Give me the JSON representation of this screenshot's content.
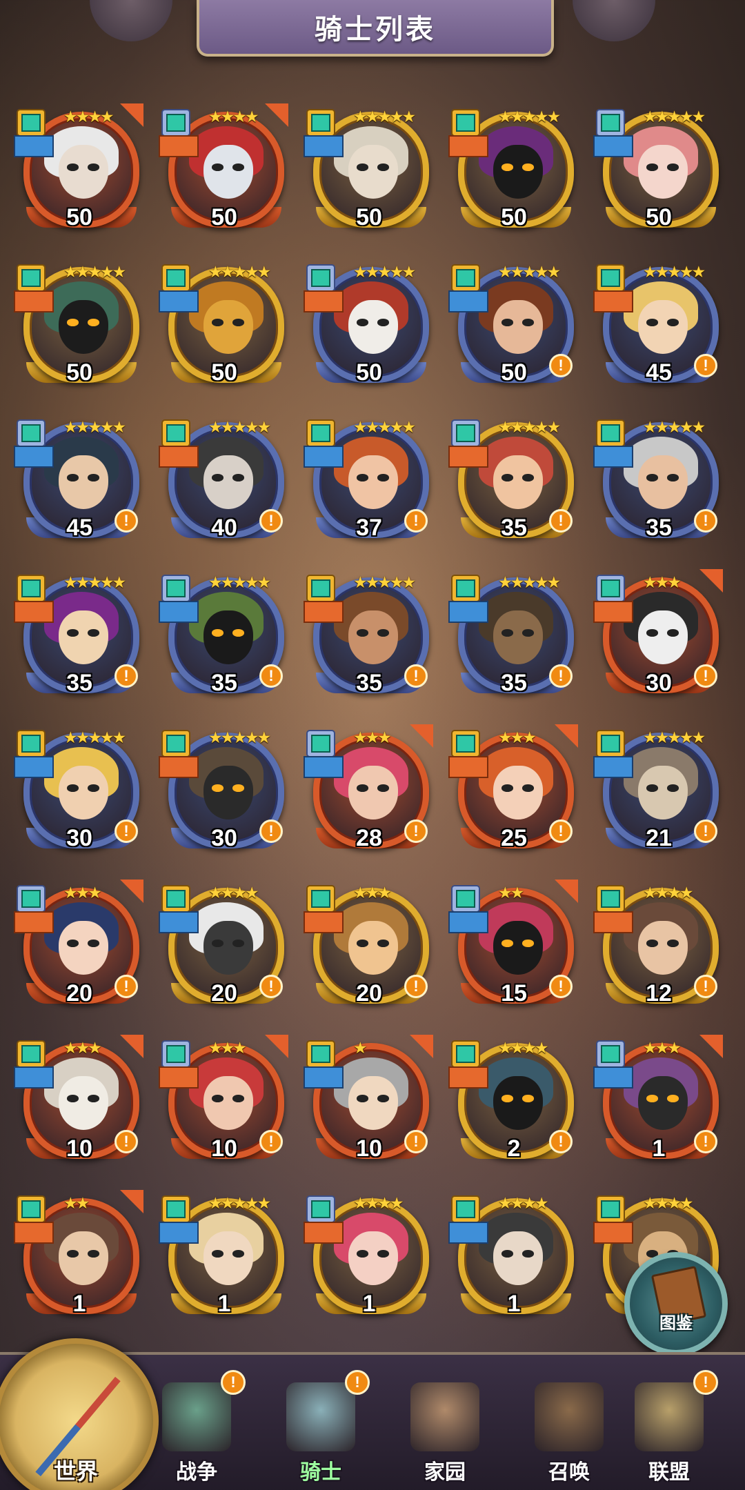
{
  "title": "骑士列表",
  "codex_label": "图鉴",
  "knights": [
    {
      "level": "50",
      "stars": "★★★★",
      "frame": "red",
      "alert": false,
      "skin": "#e8dcd0",
      "hair": "#e8e8e8"
    },
    {
      "level": "50",
      "stars": "★★★★",
      "frame": "red",
      "alert": false,
      "skin": "#e0e4ea",
      "hair": "#c03030"
    },
    {
      "level": "50",
      "stars": "★★★★★",
      "frame": "gold",
      "alert": false,
      "skin": "#e8dccc",
      "hair": "#d8d0c0"
    },
    {
      "level": "50",
      "stars": "★★★★★",
      "frame": "gold",
      "alert": false,
      "skin": "#1a1a1a",
      "hair": "#6a2c7a"
    },
    {
      "level": "50",
      "stars": "★★★★★",
      "frame": "gold",
      "alert": false,
      "skin": "#f4d6cc",
      "hair": "#e08a8a"
    },
    {
      "level": "50",
      "stars": "★★★★★",
      "frame": "gold",
      "alert": false,
      "skin": "#1c1c1c",
      "hair": "#3d6b58"
    },
    {
      "level": "50",
      "stars": "★★★★★",
      "frame": "gold",
      "alert": false,
      "skin": "#e0a43a",
      "hair": "#c07a22"
    },
    {
      "level": "50",
      "stars": "★★★★★",
      "frame": "blue",
      "alert": false,
      "skin": "#f0ede8",
      "hair": "#b03a2a"
    },
    {
      "level": "50",
      "stars": "★★★★★",
      "frame": "blue",
      "alert": true,
      "skin": "#e6b898",
      "hair": "#7a3a20"
    },
    {
      "level": "45",
      "stars": "★★★★★",
      "frame": "blue",
      "alert": true,
      "skin": "#f2d4b4",
      "hair": "#e8c46a"
    },
    {
      "level": "45",
      "stars": "★★★★★",
      "frame": "blue",
      "alert": true,
      "skin": "#e8c8a8",
      "hair": "#2a3a4a"
    },
    {
      "level": "40",
      "stars": "★★★★★",
      "frame": "blue",
      "alert": true,
      "skin": "#d8d0c8",
      "hair": "#3a3a3a"
    },
    {
      "level": "37",
      "stars": "★★★★★",
      "frame": "blue",
      "alert": true,
      "skin": "#f0c4a4",
      "hair": "#c85a2a"
    },
    {
      "level": "35",
      "stars": "★★★★★",
      "frame": "gold",
      "alert": true,
      "skin": "#f0c4a0",
      "hair": "#c04a3a"
    },
    {
      "level": "35",
      "stars": "★★★★★",
      "frame": "blue",
      "alert": true,
      "skin": "#e8c0a0",
      "hair": "#c8c8c8"
    },
    {
      "level": "35",
      "stars": "★★★★★",
      "frame": "blue",
      "alert": true,
      "skin": "#f0d4b0",
      "hair": "#7a2a8a"
    },
    {
      "level": "35",
      "stars": "★★★★★",
      "frame": "blue",
      "alert": true,
      "skin": "#1a1a1a",
      "hair": "#5a7a3a"
    },
    {
      "level": "35",
      "stars": "★★★★★",
      "frame": "blue",
      "alert": true,
      "skin": "#c8906a",
      "hair": "#7a4a2a"
    },
    {
      "level": "35",
      "stars": "★★★★★",
      "frame": "blue",
      "alert": true,
      "skin": "#8a6a4a",
      "hair": "#4a3a2a"
    },
    {
      "level": "30",
      "stars": "★★★",
      "frame": "red",
      "alert": true,
      "skin": "#eeeeee",
      "hair": "#2a2a2a"
    },
    {
      "level": "30",
      "stars": "★★★★★",
      "frame": "blue",
      "alert": true,
      "skin": "#f0d0b0",
      "hair": "#e8c050"
    },
    {
      "level": "30",
      "stars": "★★★★★",
      "frame": "blue",
      "alert": true,
      "skin": "#2a2a2a",
      "hair": "#5a4a3a"
    },
    {
      "level": "28",
      "stars": "★★★",
      "frame": "red",
      "alert": true,
      "skin": "#f0c8b0",
      "hair": "#d84a6a"
    },
    {
      "level": "25",
      "stars": "★★★",
      "frame": "red",
      "alert": true,
      "skin": "#f4d0b8",
      "hair": "#d8602a"
    },
    {
      "level": "21",
      "stars": "★★★★★",
      "frame": "blue",
      "alert": true,
      "skin": "#d8c8b0",
      "hair": "#8a7a6a"
    },
    {
      "level": "20",
      "stars": "★★★",
      "frame": "red",
      "alert": true,
      "skin": "#f4d4c0",
      "hair": "#2a3a6a"
    },
    {
      "level": "20",
      "stars": "★★★★",
      "frame": "gold",
      "alert": true,
      "skin": "#3a3a3a",
      "hair": "#e8e8e8"
    },
    {
      "level": "20",
      "stars": "★★★",
      "frame": "gold",
      "alert": true,
      "skin": "#f0c490",
      "hair": "#b07a3a"
    },
    {
      "level": "15",
      "stars": "★★",
      "frame": "red",
      "alert": true,
      "skin": "#1a1a1a",
      "hair": "#c03a5a"
    },
    {
      "level": "12",
      "stars": "★★★★",
      "frame": "gold",
      "alert": true,
      "skin": "#e8c4a4",
      "hair": "#6a4a3a"
    },
    {
      "level": "10",
      "stars": "★★★",
      "frame": "red",
      "alert": true,
      "skin": "#f0ece4",
      "hair": "#d8d0c4"
    },
    {
      "level": "10",
      "stars": "★★★",
      "frame": "red",
      "alert": true,
      "skin": "#f0c8b0",
      "hair": "#c83a3a"
    },
    {
      "level": "10",
      "stars": "★",
      "frame": "red",
      "alert": true,
      "skin": "#f0d8c0",
      "hair": "#a8a8a8"
    },
    {
      "level": "2",
      "stars": "★★★★",
      "frame": "gold",
      "alert": true,
      "skin": "#1a1a1a",
      "hair": "#3a5a6a"
    },
    {
      "level": "1",
      "stars": "★★★",
      "frame": "red",
      "alert": true,
      "skin": "#2a2a2a",
      "hair": "#7a4a8a"
    },
    {
      "level": "1",
      "stars": "★★",
      "frame": "red",
      "alert": false,
      "skin": "#e8c8a8",
      "hair": "#6a4a3a"
    },
    {
      "level": "1",
      "stars": "★★★★★",
      "frame": "gold",
      "alert": false,
      "skin": "#f0d8c0",
      "hair": "#e8d0a0"
    },
    {
      "level": "1",
      "stars": "★★★★",
      "frame": "gold",
      "alert": false,
      "skin": "#f4d0c4",
      "hair": "#d84a6a"
    },
    {
      "level": "1",
      "stars": "★★★★",
      "frame": "gold",
      "alert": false,
      "skin": "#e8d8c8",
      "hair": "#3a3a3a"
    },
    {
      "level": "",
      "stars": "★★★★",
      "frame": "gold",
      "alert": false,
      "skin": "#d8b080",
      "hair": "#7a5a3a"
    }
  ],
  "nav": {
    "world_label": "世界",
    "items": [
      {
        "label": "战争",
        "alert": true,
        "active": false,
        "color": "#6aa08a"
      },
      {
        "label": "骑士",
        "alert": true,
        "active": true,
        "color": "#8ab0b8"
      },
      {
        "label": "家园",
        "alert": false,
        "active": false,
        "color": "#b08a6a"
      },
      {
        "label": "召唤",
        "alert": false,
        "active": false,
        "color": "#8a6a4a"
      },
      {
        "label": "联盟",
        "alert": true,
        "active": false,
        "color": "#b8a06a"
      }
    ]
  }
}
